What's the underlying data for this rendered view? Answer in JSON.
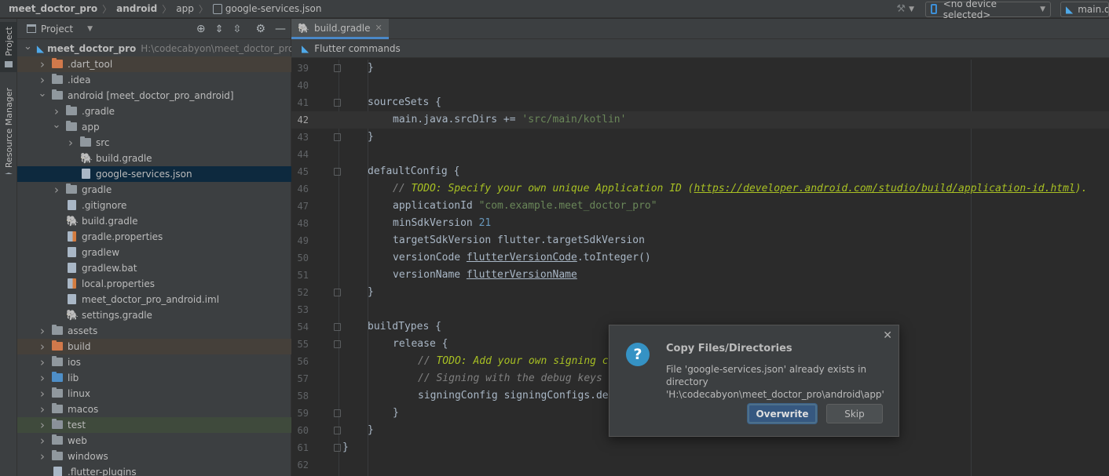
{
  "navbar": {
    "crumbs": [
      "meet_doctor_pro",
      "android",
      "app",
      "google-services.json"
    ],
    "device_selector": "<no device selected>",
    "run_config": "main.dart"
  },
  "toolstrip": {
    "tabs": [
      "Project",
      "Resource Manager"
    ]
  },
  "project_panel": {
    "title": "Project",
    "tree": [
      {
        "label": "meet_doctor_pro",
        "hint": "H:\\codecabyon\\meet_doctor_pro",
        "depth": 0,
        "arrow": "open",
        "icon": "flutter",
        "bold": true
      },
      {
        "label": ".dart_tool",
        "depth": 1,
        "arrow": "closed",
        "icon": "folder-orange",
        "hl": "brown"
      },
      {
        "label": ".idea",
        "depth": 1,
        "arrow": "closed",
        "icon": "folder-gear"
      },
      {
        "label": "android [meet_doctor_pro_android]",
        "depth": 1,
        "arrow": "open",
        "icon": "folder"
      },
      {
        "label": ".gradle",
        "depth": 2,
        "arrow": "closed",
        "icon": "folder"
      },
      {
        "label": "app",
        "depth": 2,
        "arrow": "open",
        "icon": "folder"
      },
      {
        "label": "src",
        "depth": 3,
        "arrow": "closed",
        "icon": "folder"
      },
      {
        "label": "build.gradle",
        "depth": 3,
        "arrow": "none",
        "icon": "gradle"
      },
      {
        "label": "google-services.json",
        "depth": 3,
        "arrow": "none",
        "icon": "json",
        "selected": true
      },
      {
        "label": "gradle",
        "depth": 2,
        "arrow": "closed",
        "icon": "folder"
      },
      {
        "label": ".gitignore",
        "depth": 2,
        "arrow": "none",
        "icon": "file"
      },
      {
        "label": "build.gradle",
        "depth": 2,
        "arrow": "none",
        "icon": "gradle"
      },
      {
        "label": "gradle.properties",
        "depth": 2,
        "arrow": "none",
        "icon": "props"
      },
      {
        "label": "gradlew",
        "depth": 2,
        "arrow": "none",
        "icon": "file"
      },
      {
        "label": "gradlew.bat",
        "depth": 2,
        "arrow": "none",
        "icon": "file"
      },
      {
        "label": "local.properties",
        "depth": 2,
        "arrow": "none",
        "icon": "props"
      },
      {
        "label": "meet_doctor_pro_android.iml",
        "depth": 2,
        "arrow": "none",
        "icon": "file"
      },
      {
        "label": "settings.gradle",
        "depth": 2,
        "arrow": "none",
        "icon": "gradle"
      },
      {
        "label": "assets",
        "depth": 1,
        "arrow": "closed",
        "icon": "folder"
      },
      {
        "label": "build",
        "depth": 1,
        "arrow": "closed",
        "icon": "folder-orange",
        "hl": "brown"
      },
      {
        "label": "ios",
        "depth": 1,
        "arrow": "closed",
        "icon": "folder"
      },
      {
        "label": "lib",
        "depth": 1,
        "arrow": "closed",
        "icon": "folder-blue"
      },
      {
        "label": "linux",
        "depth": 1,
        "arrow": "closed",
        "icon": "folder"
      },
      {
        "label": "macos",
        "depth": 1,
        "arrow": "closed",
        "icon": "folder"
      },
      {
        "label": "test",
        "depth": 1,
        "arrow": "closed",
        "icon": "folder-green",
        "hl": "green"
      },
      {
        "label": "web",
        "depth": 1,
        "arrow": "closed",
        "icon": "folder"
      },
      {
        "label": "windows",
        "depth": 1,
        "arrow": "closed",
        "icon": "folder"
      },
      {
        "label": ".flutter-plugins",
        "depth": 1,
        "arrow": "none",
        "icon": "file"
      }
    ]
  },
  "editor": {
    "tab": "build.gradle",
    "flutter_bar": "Flutter commands",
    "current_line": 42,
    "lines": [
      {
        "n": "39",
        "fold": true,
        "indent": 1,
        "parts": [
          [
            "}",
            ""
          ]
        ]
      },
      {
        "n": "40",
        "indent": 0,
        "parts": []
      },
      {
        "n": "41",
        "fold": true,
        "indent": 1,
        "parts": [
          [
            "sourceSets {",
            ""
          ]
        ]
      },
      {
        "n": "42",
        "indent": 2,
        "parts": [
          [
            "main.java.srcDirs += ",
            ""
          ],
          [
            "'src/main/kotlin'",
            "str"
          ]
        ]
      },
      {
        "n": "43",
        "fold": true,
        "indent": 1,
        "parts": [
          [
            "}",
            ""
          ]
        ]
      },
      {
        "n": "44",
        "indent": 0,
        "parts": []
      },
      {
        "n": "45",
        "fold": true,
        "indent": 1,
        "parts": [
          [
            "defaultConfig {",
            ""
          ]
        ]
      },
      {
        "n": "46",
        "indent": 2,
        "parts": [
          [
            "// ",
            "cmt"
          ],
          [
            "TODO: Specify your own unique Application ID (",
            "todo"
          ],
          [
            "https://developer.android.com/studio/build/application-id.html",
            "todo-u"
          ],
          [
            ").",
            "todo"
          ]
        ]
      },
      {
        "n": "47",
        "indent": 2,
        "parts": [
          [
            "applicationId ",
            ""
          ],
          [
            "\"com.example.meet_doctor_pro\"",
            "str"
          ]
        ]
      },
      {
        "n": "48",
        "indent": 2,
        "parts": [
          [
            "minSdkVersion ",
            ""
          ],
          [
            "21",
            "num"
          ]
        ]
      },
      {
        "n": "49",
        "indent": 2,
        "parts": [
          [
            "targetSdkVersion flutter.targetSdkVersion",
            ""
          ]
        ]
      },
      {
        "n": "50",
        "indent": 2,
        "parts": [
          [
            "versionCode ",
            ""
          ],
          [
            "flutterVersionCode",
            "und"
          ],
          [
            ".toInteger()",
            ""
          ]
        ]
      },
      {
        "n": "51",
        "indent": 2,
        "parts": [
          [
            "versionName ",
            ""
          ],
          [
            "flutterVersionName",
            "und"
          ]
        ]
      },
      {
        "n": "52",
        "fold": true,
        "indent": 1,
        "parts": [
          [
            "}",
            ""
          ]
        ]
      },
      {
        "n": "53",
        "indent": 0,
        "parts": []
      },
      {
        "n": "54",
        "fold": true,
        "indent": 1,
        "parts": [
          [
            "buildTypes {",
            ""
          ]
        ]
      },
      {
        "n": "55",
        "fold": true,
        "indent": 2,
        "parts": [
          [
            "release {",
            ""
          ]
        ]
      },
      {
        "n": "56",
        "indent": 3,
        "parts": [
          [
            "// ",
            "cmt"
          ],
          [
            "TODO: Add your own signing c",
            "todo"
          ]
        ]
      },
      {
        "n": "57",
        "indent": 3,
        "parts": [
          [
            "// Signing with the debug keys",
            "cmt"
          ]
        ]
      },
      {
        "n": "58",
        "indent": 3,
        "parts": [
          [
            "signingConfig signingConfigs.de",
            ""
          ]
        ]
      },
      {
        "n": "59",
        "fold": true,
        "indent": 2,
        "parts": [
          [
            "}",
            ""
          ]
        ]
      },
      {
        "n": "60",
        "fold": true,
        "indent": 1,
        "parts": [
          [
            "}",
            ""
          ]
        ]
      },
      {
        "n": "61",
        "fold": true,
        "indent": 0,
        "parts": [
          [
            "}",
            ""
          ]
        ]
      },
      {
        "n": "62",
        "indent": 0,
        "parts": []
      }
    ]
  },
  "dialog": {
    "title": "Copy Files/Directories",
    "message_line1": "File 'google-services.json' already exists in directory",
    "message_line2": "'H:\\codecabyon\\meet_doctor_pro\\android\\app'",
    "overwrite_label": "Overwrite",
    "skip_label": "Skip",
    "icon_glyph": "?"
  },
  "colors": {
    "selection": "#0d293e",
    "accent": "#4a88c7",
    "primary_button": "#365880"
  }
}
